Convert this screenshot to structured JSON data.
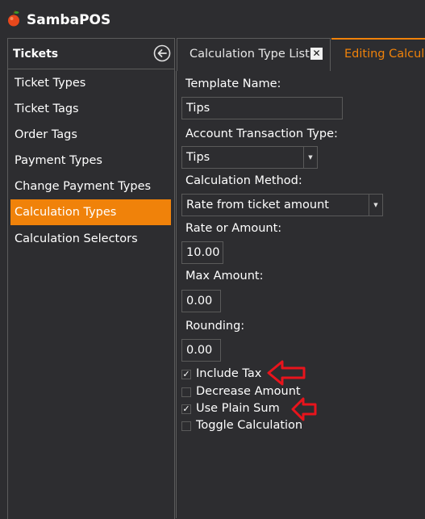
{
  "app": {
    "title": "SambaPOS",
    "accent_color": "#f0820a",
    "logo_icon": "apple-logo-icon"
  },
  "left_panel": {
    "header": "Tickets",
    "back_icon": "circle-arrow-left-icon",
    "items": [
      {
        "label": "Ticket Types",
        "active": false
      },
      {
        "label": "Ticket Tags",
        "active": false
      },
      {
        "label": "Order Tags",
        "active": false
      },
      {
        "label": "Payment Types",
        "active": false
      },
      {
        "label": "Change Payment Types",
        "active": false
      },
      {
        "label": "Calculation Types",
        "active": true
      },
      {
        "label": "Calculation Selectors",
        "active": false
      }
    ]
  },
  "tabs": [
    {
      "label": "Calculation Type List",
      "close_icon": "close-icon"
    },
    {
      "label": "Editing Calcula",
      "active": true
    }
  ],
  "form": {
    "template_name_label": "Template Name:",
    "template_name_value": "Tips",
    "account_transaction_type_label": "Account Transaction Type:",
    "account_transaction_type_value": "Tips",
    "calculation_method_label": "Calculation Method:",
    "calculation_method_value": "Rate from ticket amount",
    "rate_label": "Rate or Amount:",
    "rate_value": "10.00",
    "max_amount_label": "Max Amount:",
    "max_amount_value": "0.00",
    "rounding_label": "Rounding:",
    "rounding_value": "0.00",
    "checkboxes": [
      {
        "label": "Include Tax",
        "checked": true,
        "annotated": true
      },
      {
        "label": "Decrease Amount",
        "checked": false,
        "annotated": false
      },
      {
        "label": "Use Plain Sum",
        "checked": true,
        "annotated": true
      },
      {
        "label": "Toggle Calculation",
        "checked": false,
        "annotated": false
      }
    ]
  },
  "annotation": {
    "arrow_color": "#e8141c",
    "arrow_icon": "red-outline-arrow-left-icon"
  }
}
